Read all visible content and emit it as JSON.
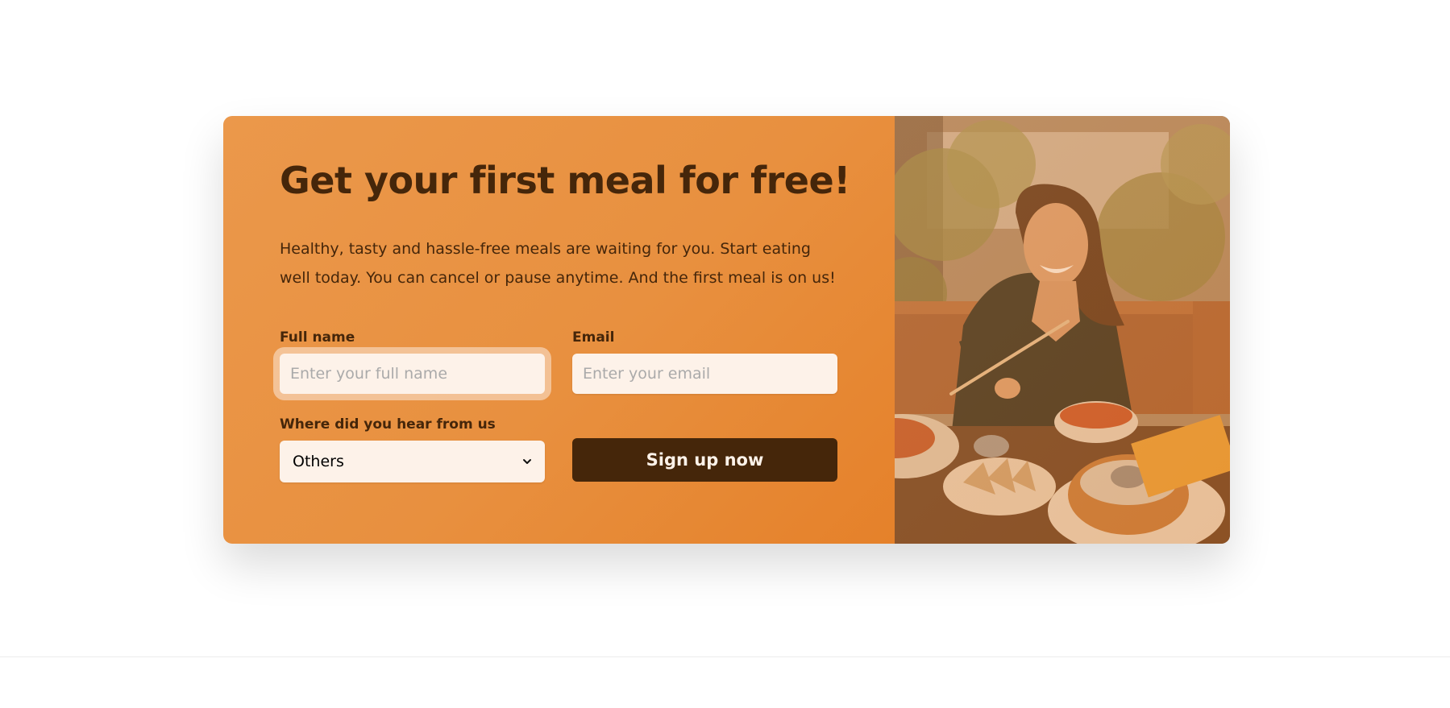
{
  "cta": {
    "title": "Get your first meal for free!",
    "description": "Healthy, tasty and hassle-free meals are waiting for you. Start eating well today. You can cancel or pause anytime. And the first meal is on us!",
    "form": {
      "full_name": {
        "label": "Full name",
        "placeholder": "Enter your full name",
        "value": ""
      },
      "email": {
        "label": "Email",
        "placeholder": "Enter your email",
        "value": ""
      },
      "source": {
        "label": "Where did you hear from us",
        "selected": "Others"
      },
      "submit_label": "Sign up now"
    },
    "image": {
      "icon": "woman-eating-meal-photo"
    }
  },
  "colors": {
    "brand_orange": "#e67e22",
    "dark_brown": "#45260a",
    "input_bg": "#fdf2e9"
  }
}
